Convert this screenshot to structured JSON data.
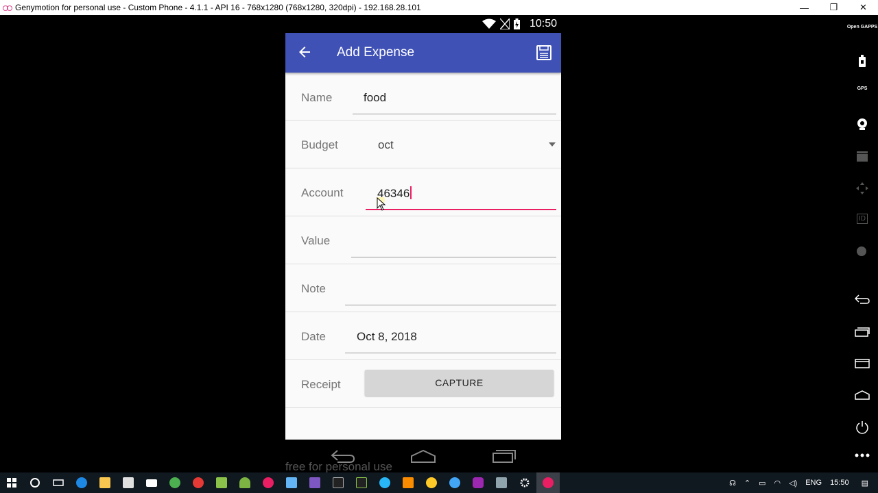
{
  "window": {
    "title": "Genymotion for personal use - Custom Phone - 4.1.1 - API 16 - 768x1280 (768x1280, 320dpi) - 192.168.28.101",
    "minimize": "—",
    "maximize": "❐",
    "close": "✕"
  },
  "statusbar": {
    "time": "10:50"
  },
  "appbar": {
    "title": "Add Expense"
  },
  "form": {
    "name": {
      "label": "Name",
      "value": "food"
    },
    "budget": {
      "label": "Budget",
      "value": "oct"
    },
    "account": {
      "label": "Account",
      "value": "46346"
    },
    "value": {
      "label": "Value",
      "value": ""
    },
    "note": {
      "label": "Note",
      "value": ""
    },
    "date": {
      "label": "Date",
      "value": "Oct 8, 2018"
    },
    "receipt": {
      "label": "Receipt",
      "button": "CAPTURE"
    }
  },
  "watermark": "free for personal use",
  "gm_toolbar": {
    "open_gapps": "Open GAPPS",
    "gps": "GPS",
    "id": "ID"
  },
  "tray": {
    "lang": "ENG",
    "time": "15:50"
  },
  "colors": {
    "appbar": "#3f51b5",
    "accent": "#e91e63"
  }
}
